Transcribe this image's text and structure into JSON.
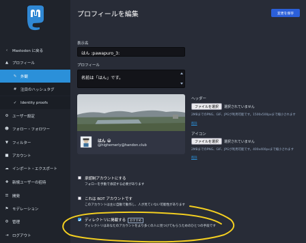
{
  "sidebar": {
    "back": "Mastodon に戻る",
    "items": [
      {
        "icon": "user-icon",
        "glyph": "▲",
        "label": "プロフィール",
        "sub": false,
        "active": false
      },
      {
        "icon": "pencil-icon",
        "glyph": "✎",
        "label": "外観",
        "sub": true,
        "active": true
      },
      {
        "icon": "hashtag-icon",
        "glyph": "#",
        "label": "注目のハッシュタグ",
        "sub": true,
        "active": false
      },
      {
        "icon": "check-icon",
        "glyph": "✓",
        "label": "Identity proofs",
        "sub": true,
        "active": false
      },
      {
        "icon": "gear-icon",
        "glyph": "⚙",
        "label": "ユーザー設定",
        "sub": false,
        "active": false
      },
      {
        "icon": "users-icon",
        "glyph": "☻",
        "label": "フォロー・フォロワー",
        "sub": false,
        "active": false
      },
      {
        "icon": "filter-icon",
        "glyph": "▼",
        "label": "フィルター",
        "sub": false,
        "active": false
      },
      {
        "icon": "lock-icon",
        "glyph": "■",
        "label": "アカウント",
        "sub": false,
        "active": false
      },
      {
        "icon": "cloud-icon",
        "glyph": "☁",
        "label": "インポート・エクスポート",
        "sub": false,
        "active": false
      },
      {
        "icon": "user-plus-icon",
        "glyph": "✚",
        "label": "新規ユーザーの招待",
        "sub": false,
        "active": false
      },
      {
        "icon": "list-icon",
        "glyph": "☰",
        "label": "開発",
        "sub": false,
        "active": false
      },
      {
        "icon": "flag-icon",
        "glyph": "⚑",
        "label": "モデレーション",
        "sub": false,
        "active": false
      },
      {
        "icon": "cogs-icon",
        "glyph": "⚙",
        "label": "管理",
        "sub": false,
        "active": false
      },
      {
        "icon": "logout-icon",
        "glyph": "⇥",
        "label": "ログアウト",
        "sub": false,
        "active": false
      }
    ]
  },
  "main": {
    "title": "プロフィールを編集",
    "save_label": "変更を保存",
    "display_name": {
      "label": "表示名",
      "value": "はん :pawapuro_3:"
    },
    "bio": {
      "label": "プロフィール",
      "value": "名前は「はん」です。"
    },
    "preview": {
      "name": "はん",
      "emoji": "😀",
      "acct": "@highemerly@handon.club"
    },
    "header": {
      "label": "ヘッダー",
      "button": "ファイルを選択",
      "none": "選択されていません",
      "hint": "2MBまでのPNG、GIF、JPGが利用可能です。1500x500pxまで縮小されます",
      "delete": "削除"
    },
    "avatar": {
      "label": "アイコン",
      "button": "ファイルを選択",
      "none": "選択されていません",
      "hint": "2MBまでのPNG、GIF、JPGが利用可能です。400x400pxまで縮小されます",
      "delete": "削除"
    },
    "options": [
      {
        "title": "承認制アカウントにする",
        "desc": "フォローを手動で承認する必要があります",
        "checked": false,
        "badge": ""
      },
      {
        "title": "これは BOT アカウントです",
        "desc": "このアカウントは主に自動で動作し、人が見ていない可能性があります",
        "checked": false,
        "badge": ""
      },
      {
        "title": "ディレクトリに掲載する",
        "desc": "ディレクトリはあなたのアカウントをより多くの人に見つけてもらうためのひとつの手段です",
        "checked": true,
        "badge": "おすすめ"
      }
    ]
  },
  "colors": {
    "accent": "#2b90d9",
    "save": "#2b5fd9",
    "annotation": "#f5d020"
  }
}
